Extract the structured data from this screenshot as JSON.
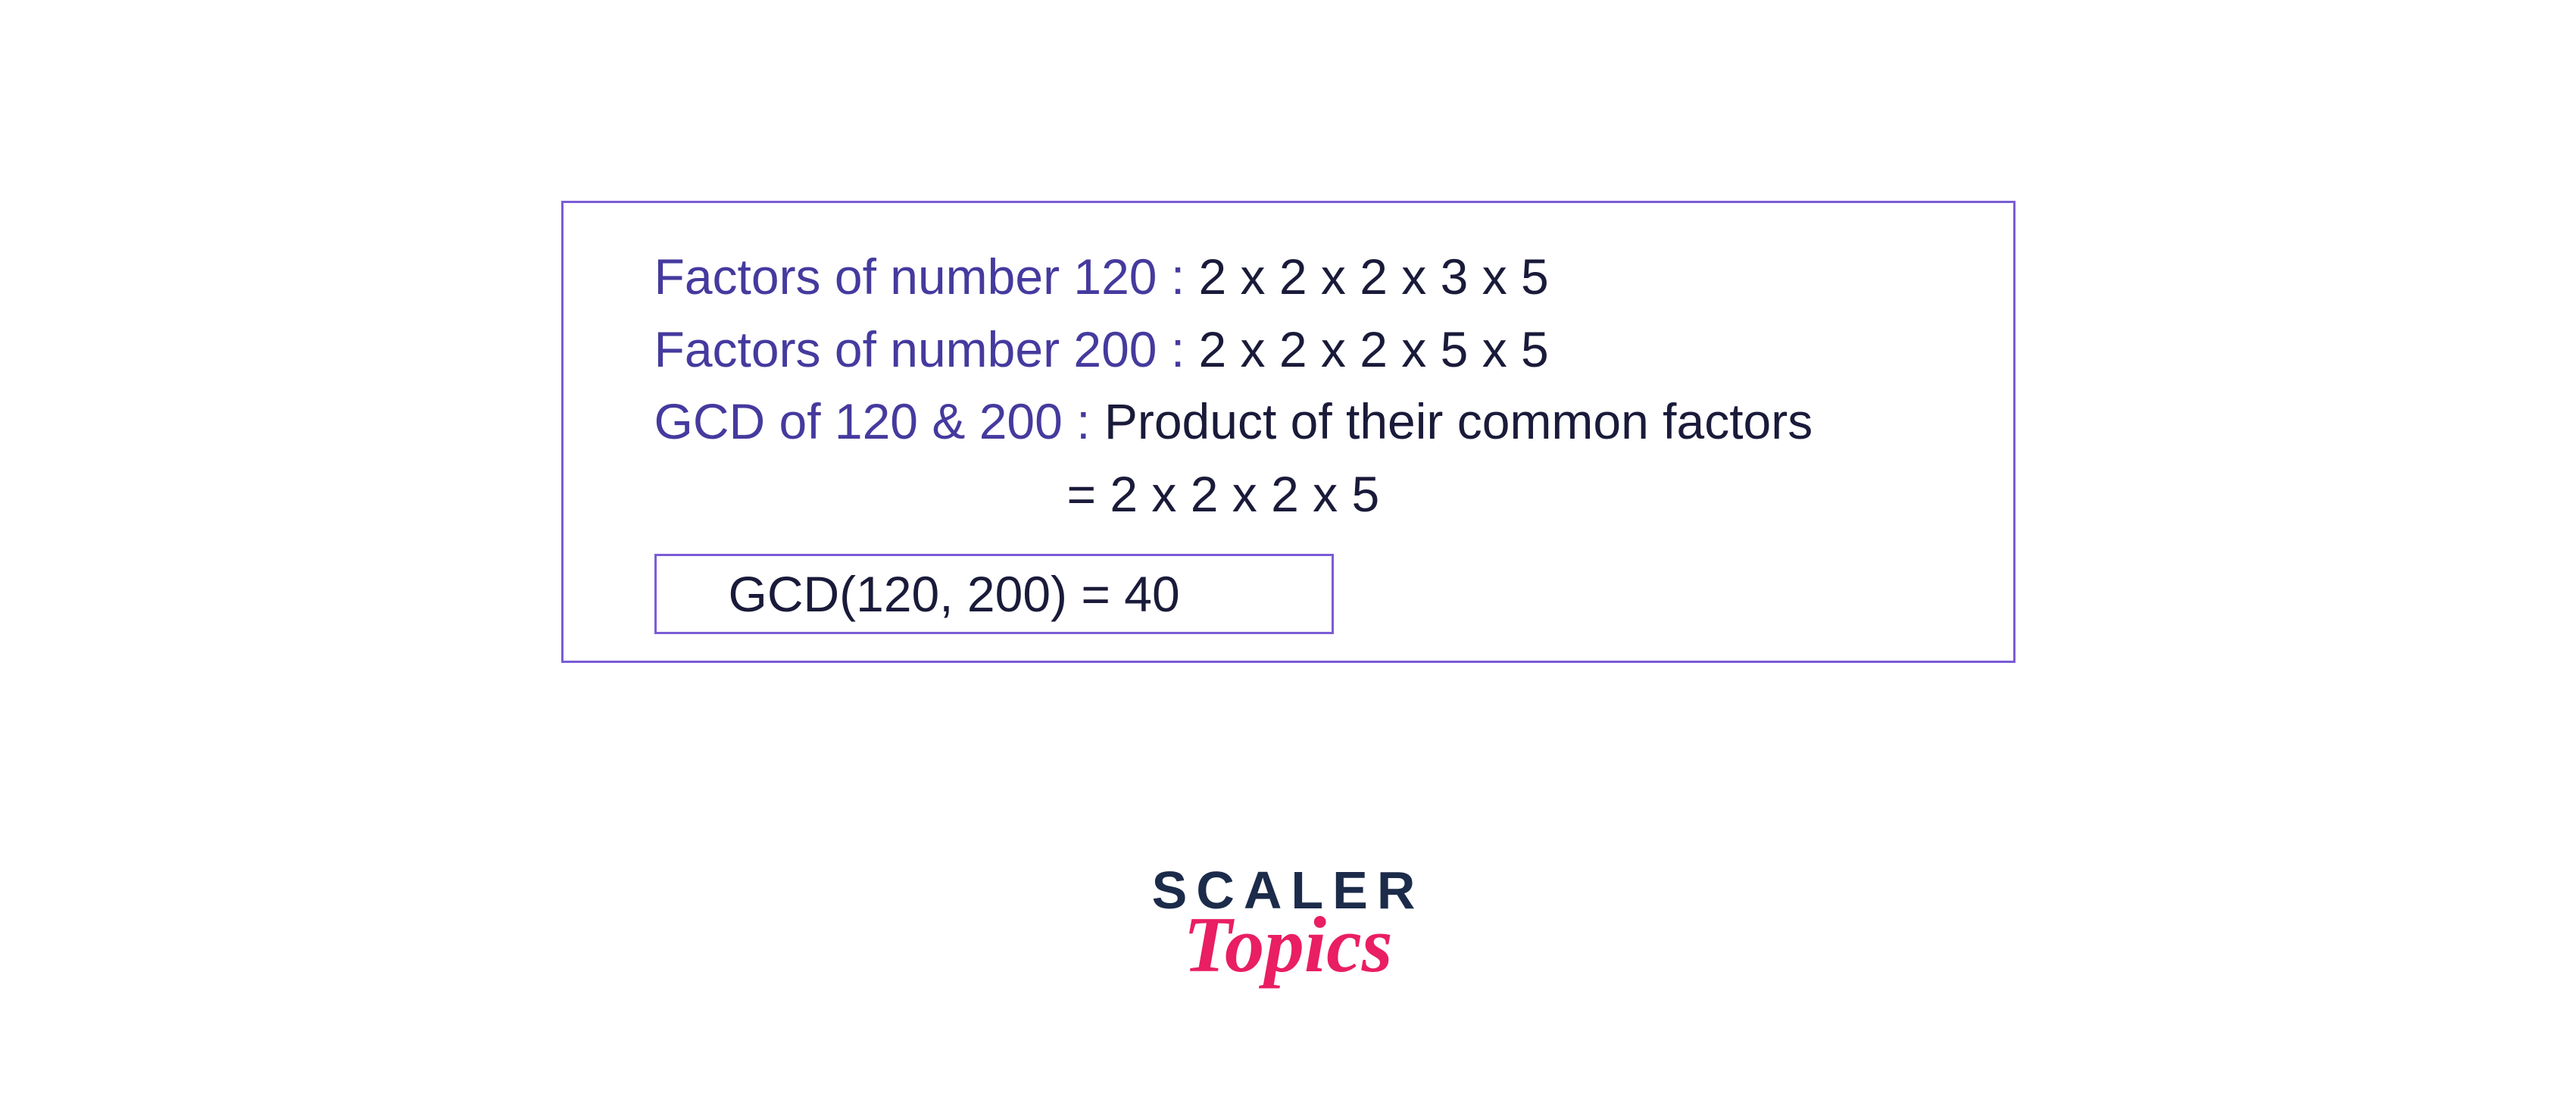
{
  "content": {
    "line1": {
      "label": "Factors of number 120 :",
      "value": " 2 x 2 x 2 x 3 x 5"
    },
    "line2": {
      "label": "Factors of number 200 :",
      "value": " 2 x 2 x 2 x 5 x 5"
    },
    "line3": {
      "label": "GCD of 120 & 200 :",
      "value": " Product of their common factors"
    },
    "line4": "= 2 x 2 x 2 x 5",
    "result": "GCD(120, 200) = 40"
  },
  "logo": {
    "top": "SCALER",
    "bottom": "Topics"
  }
}
